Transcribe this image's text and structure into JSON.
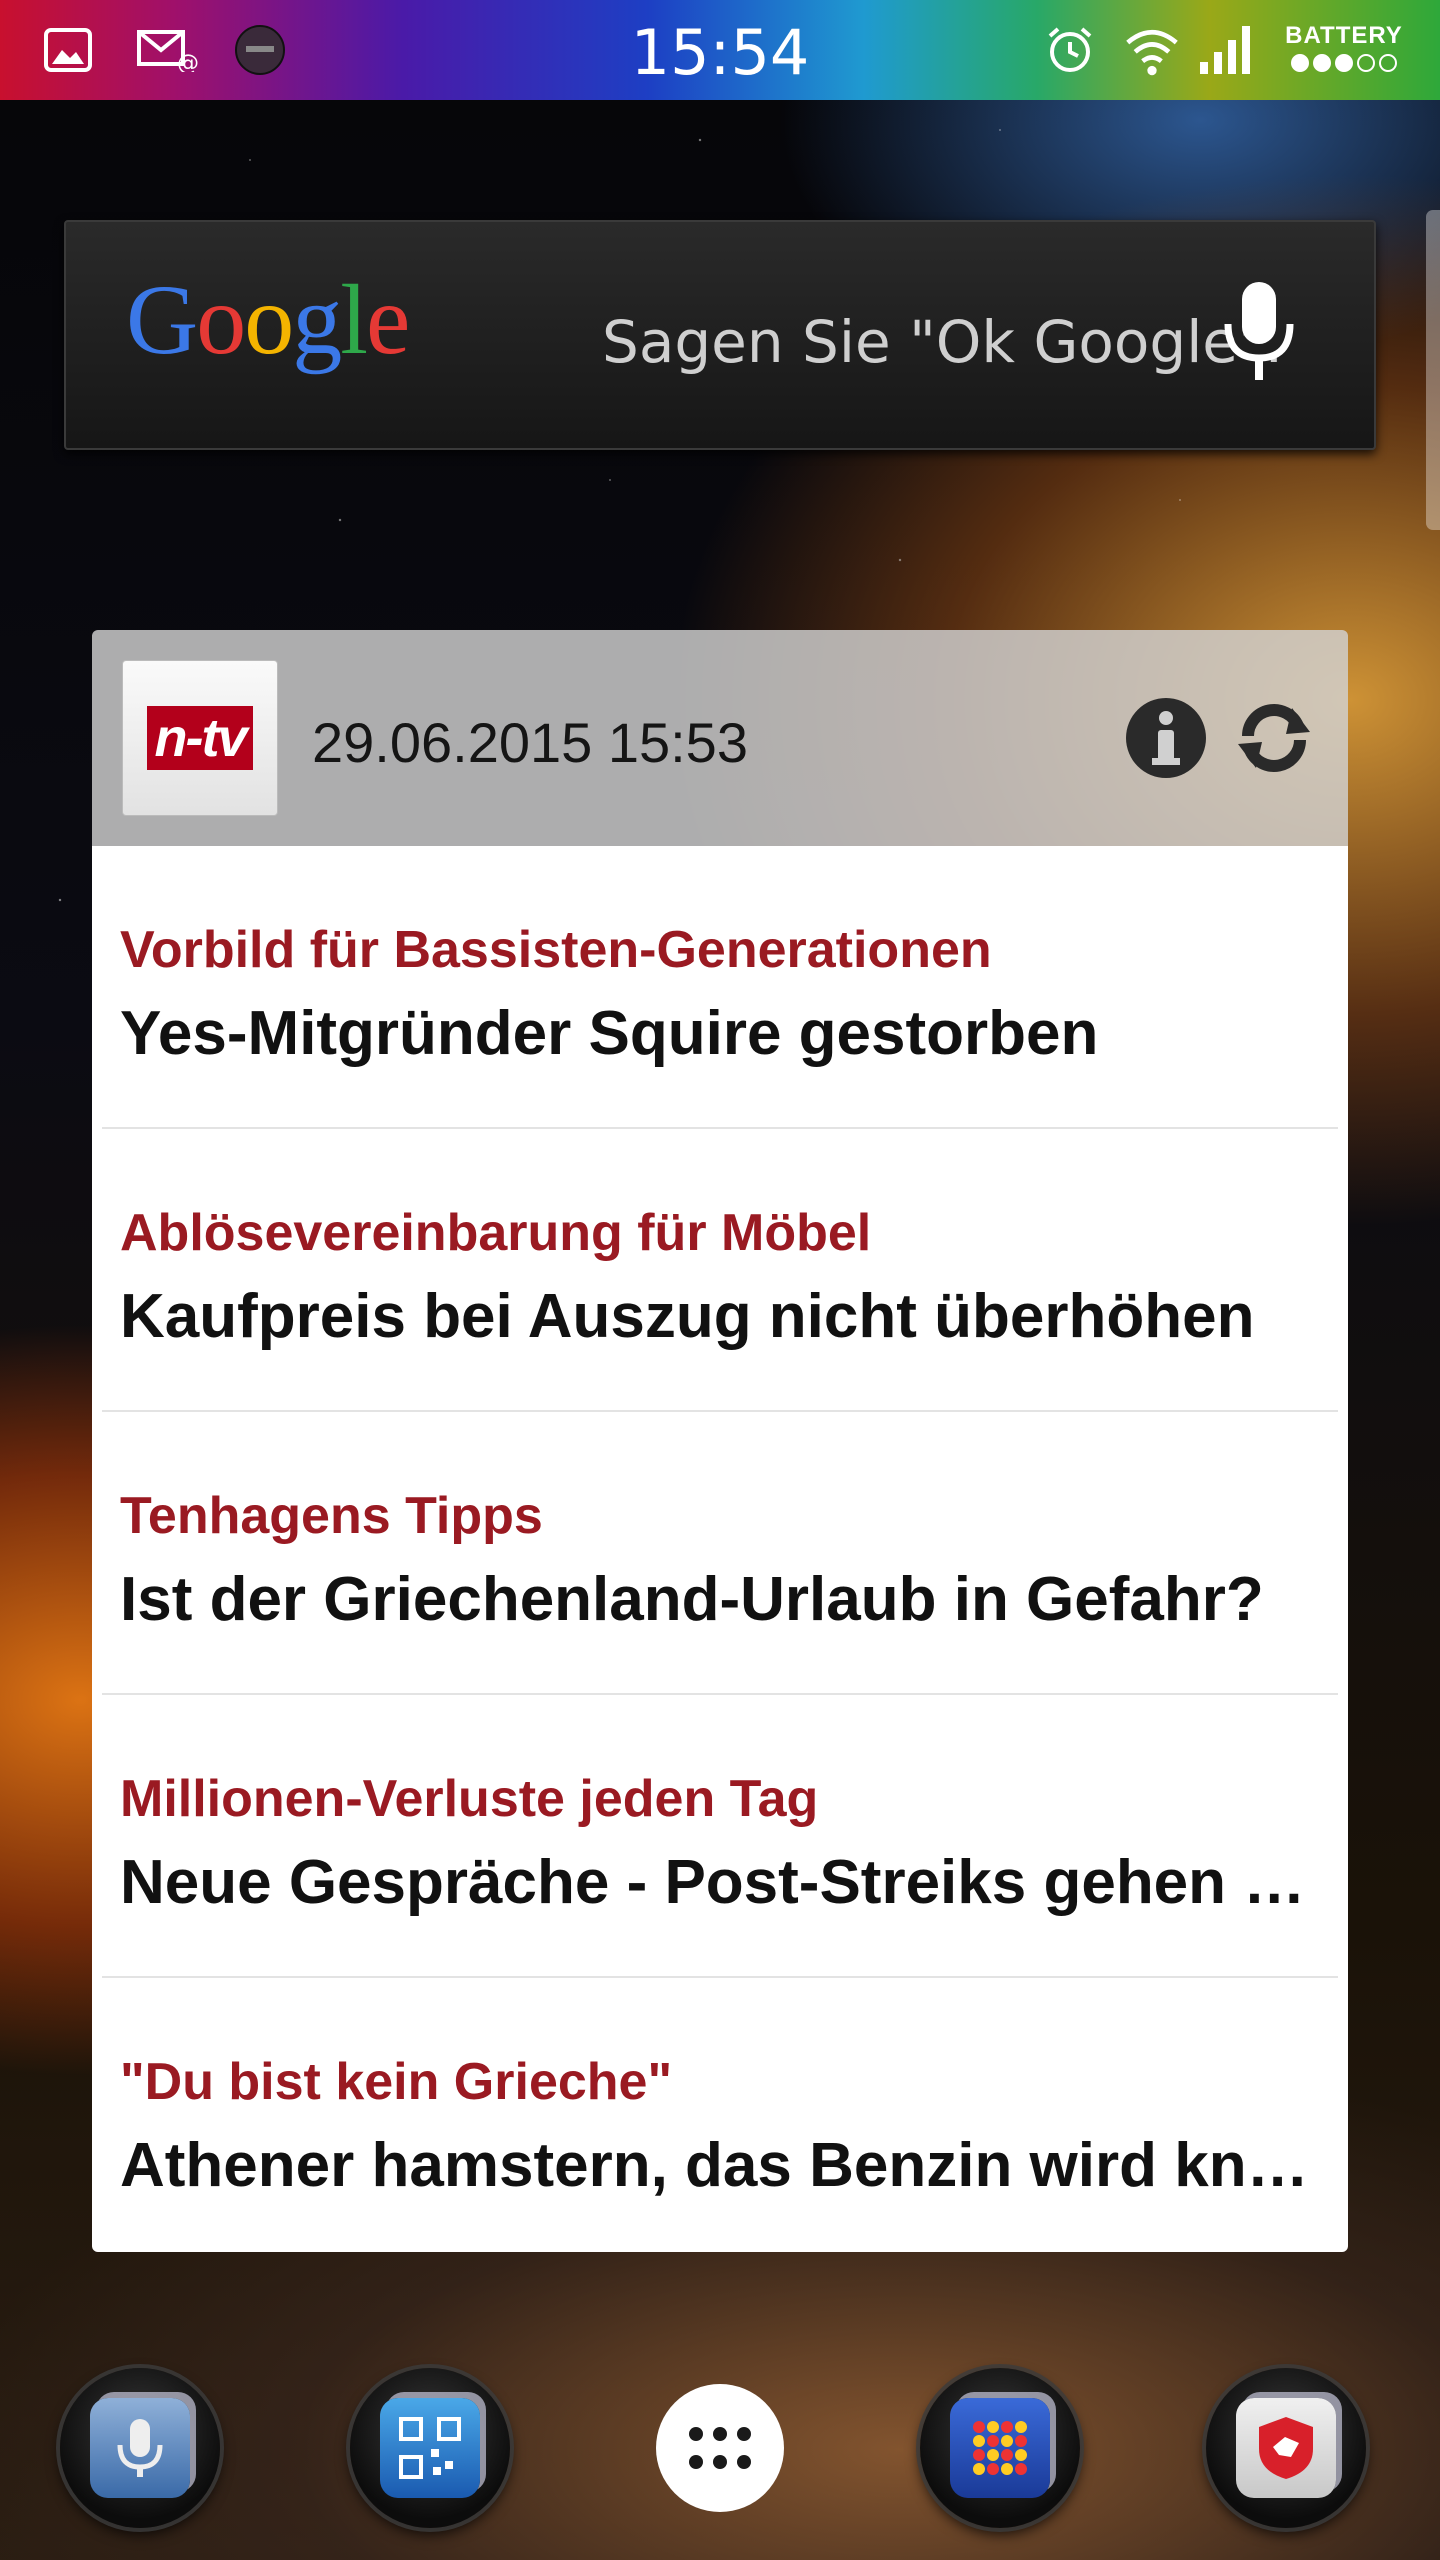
{
  "status_bar": {
    "time": "15:54",
    "battery_label": "BATTERY",
    "battery_level": 0.6,
    "icons": [
      "gallery-icon",
      "email-icon",
      "app-icon",
      "alarm-icon",
      "wifi-icon",
      "signal-icon"
    ]
  },
  "google_bar": {
    "logo_letters": [
      "G",
      "o",
      "o",
      "g",
      "l",
      "e"
    ],
    "hint": "Sagen Sie \"Ok Google\"."
  },
  "widget": {
    "logo_text": "n-tv",
    "timestamp": "29.06.2015 15:53",
    "accent_color": "#9a1a22",
    "items": [
      {
        "kicker": "Vorbild für Bassisten-Generationen",
        "headline": "Yes-Mitgründer Squire gestorben"
      },
      {
        "kicker": "Ablösevereinbarung für Möbel",
        "headline": "Kaufpreis bei Auszug nicht überhöhen"
      },
      {
        "kicker": "Tenhagens Tipps",
        "headline": "Ist der Griechenland-Urlaub in Gefahr?"
      },
      {
        "kicker": "Millionen-Verluste jeden Tag",
        "headline": "Neue Gespräche - Post-Streiks gehen w…"
      },
      {
        "kicker": "\"Du bist kein Grieche\"",
        "headline": "Athener hamstern, das Benzin wird knapp"
      }
    ]
  },
  "dock": {
    "icons": [
      "voice-folder-icon",
      "qr-folder-icon",
      "app-drawer-icon",
      "games-folder-icon",
      "security-folder-icon"
    ]
  }
}
